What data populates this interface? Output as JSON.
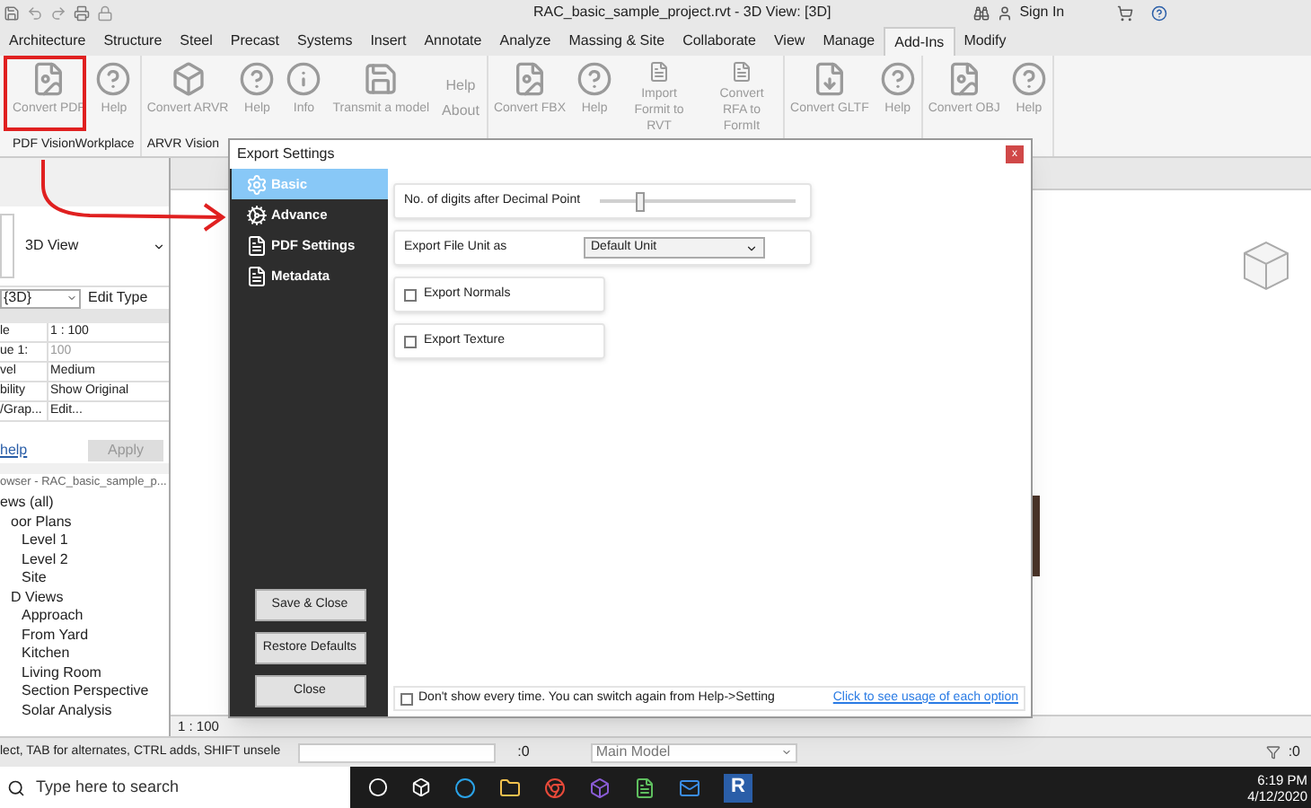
{
  "window": {
    "title": "RAC_basic_sample_project.rvt - 3D View: [3D]",
    "sign_in": "Sign In"
  },
  "ribbon_tabs": [
    {
      "label": "Architecture",
      "selected": false
    },
    {
      "label": "Structure",
      "selected": false
    },
    {
      "label": "Steel",
      "selected": false
    },
    {
      "label": "Precast",
      "selected": false
    },
    {
      "label": "Systems",
      "selected": false
    },
    {
      "label": "Insert",
      "selected": false
    },
    {
      "label": "Annotate",
      "selected": false
    },
    {
      "label": "Analyze",
      "selected": false
    },
    {
      "label": "Massing & Site",
      "selected": false
    },
    {
      "label": "Collaborate",
      "selected": false
    },
    {
      "label": "View",
      "selected": false
    },
    {
      "label": "Manage",
      "selected": false
    },
    {
      "label": "Add-Ins",
      "selected": true
    },
    {
      "label": "Modify",
      "selected": false
    }
  ],
  "ribbon_groups": [
    {
      "label": "PDF VisionWorkplace",
      "buttons": [
        {
          "kind": "pdf",
          "label": "Convert PDF"
        },
        {
          "kind": "help",
          "label": "Help"
        }
      ]
    },
    {
      "label": "ARVR Vision",
      "buttons": [
        {
          "kind": "arvr",
          "label": "Convert ARVR"
        },
        {
          "kind": "help",
          "label": "Help"
        },
        {
          "kind": "info",
          "label": "Info"
        },
        {
          "kind": "transmit",
          "label": "Transmit a model"
        },
        {
          "kind": "stack",
          "label": "Help",
          "label2": "About"
        }
      ]
    },
    {
      "buttons": [
        {
          "kind": "file",
          "label": "Convert FBX"
        },
        {
          "kind": "help",
          "label": "Help"
        },
        {
          "kind": "formit",
          "label": "Import Formit to RVT"
        },
        {
          "kind": "rfa",
          "label": "Convert RFA to FormIt"
        }
      ]
    },
    {
      "buttons": [
        {
          "kind": "gltf",
          "label": "Convert GLTF"
        },
        {
          "kind": "help",
          "label": "Help"
        }
      ]
    },
    {
      "buttons": [
        {
          "kind": "file",
          "label": "Convert OBJ"
        },
        {
          "kind": "help",
          "label": "Help"
        }
      ]
    }
  ],
  "properties": {
    "type_name": "3D View",
    "instance": "{3D}",
    "edit_type": "Edit Type",
    "rows": [
      {
        "name": "le",
        "value": "1 : 100",
        "disabled": false
      },
      {
        "name": "ue  1:",
        "value": "100",
        "disabled": true
      },
      {
        "name": "vel",
        "value": "Medium",
        "disabled": false
      },
      {
        "name": "bility",
        "value": "Show Original",
        "disabled": false
      },
      {
        "name": "/Grap...",
        "value": "Edit...",
        "disabled": false
      }
    ],
    "help_link": "help",
    "apply": "Apply"
  },
  "project_browser": {
    "title": "owser - RAC_basic_sample_p...",
    "tree": [
      {
        "label": "ews (all)",
        "children": [
          {
            "label": "oor Plans",
            "children": [
              {
                "label": "Level 1"
              },
              {
                "label": "Level 2"
              },
              {
                "label": "Site"
              }
            ]
          },
          {
            "label": "D Views",
            "children": [
              {
                "label": "Approach"
              },
              {
                "label": "From Yard"
              },
              {
                "label": "Kitchen"
              },
              {
                "label": "Living Room"
              },
              {
                "label": "Section Perspective"
              },
              {
                "label": "Solar Analysis"
              }
            ]
          }
        ]
      }
    ]
  },
  "view": {
    "scale": "1 : 100"
  },
  "dialog": {
    "title": "Export Settings",
    "close": "x",
    "nav": [
      {
        "kind": "gear",
        "label": "Basic",
        "selected": true
      },
      {
        "kind": "gears",
        "label": "Advance",
        "selected": false
      },
      {
        "kind": "pdf",
        "label": "PDF Settings",
        "selected": false
      },
      {
        "kind": "doc",
        "label": "Metadata",
        "selected": false
      }
    ],
    "settings": [
      {
        "kind": "slider",
        "label": "No. of digits after Decimal Point",
        "level": 0.22
      },
      {
        "kind": "select",
        "label": "Export File Unit as",
        "value": "Default Unit"
      },
      {
        "kind": "checkbox",
        "label": "Export Normals",
        "checked": false
      },
      {
        "kind": "checkbox",
        "label": "Export Texture",
        "checked": false
      }
    ],
    "buttons": [
      "Save & Close",
      "Restore Defaults",
      "Close"
    ],
    "footer": {
      "label": "Don't show every time. You can switch again from Help->Setting",
      "checked": false,
      "link": "Click to see usage of each option"
    }
  },
  "status_bar": {
    "text": "lect, TAB for alternates, CTRL adds, SHIFT unsele",
    "count": ":0",
    "model": "Main Model",
    "filter_count": ":0"
  },
  "taskbar": {
    "search_placeholder": "Type here to search",
    "revit_glyph": "R",
    "time": "6:19 PM",
    "date": "4/12/2020"
  }
}
